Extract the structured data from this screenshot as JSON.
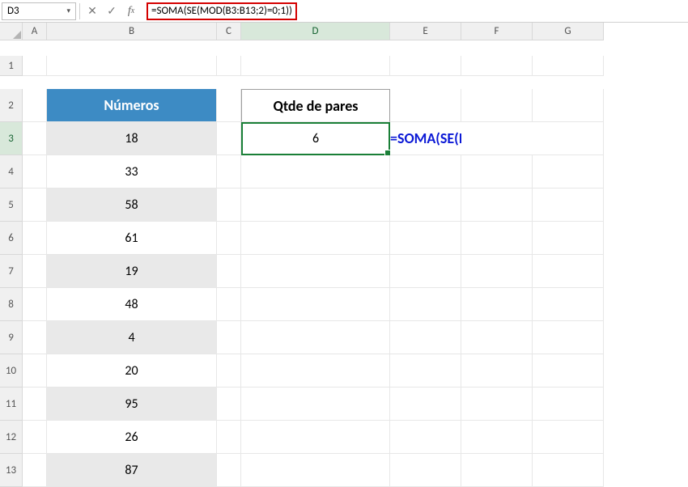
{
  "nameBox": "D3",
  "formulaBar": "=SOMA(SE(MOD(B3:B13;2)=0;1))",
  "annotation": "=SOMA(SE(MOD(B3:B13;2)=0;1))",
  "resultCell": "6",
  "columns": [
    "A",
    "B",
    "C",
    "D",
    "E",
    "F",
    "G"
  ],
  "rows": [
    "1",
    "2",
    "3",
    "4",
    "5",
    "6",
    "7",
    "8",
    "9",
    "10",
    "11",
    "12",
    "13"
  ],
  "headerNumeros": "Números",
  "headerQtde": "Qtde de pares",
  "numeros": [
    "18",
    "33",
    "58",
    "61",
    "19",
    "48",
    "4",
    "20",
    "95",
    "26",
    "87"
  ]
}
